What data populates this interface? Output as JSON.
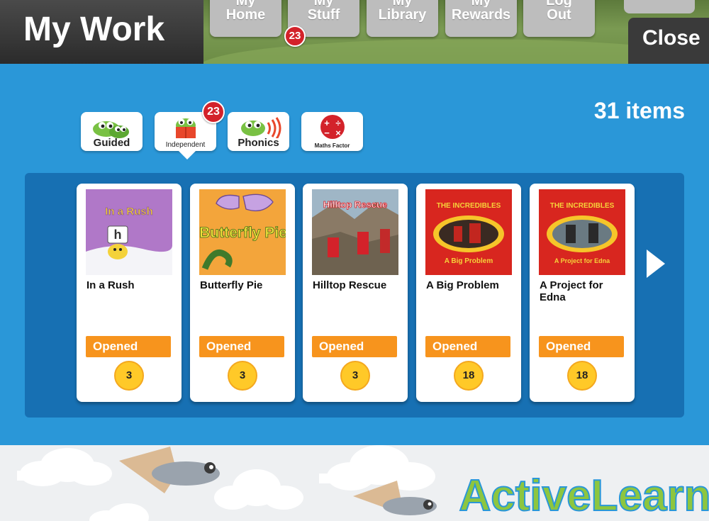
{
  "header": {
    "title": "My Work"
  },
  "nav": [
    {
      "line1": "My",
      "line2": "Home"
    },
    {
      "line1": "My",
      "line2": "Stuff"
    },
    {
      "line1": "My",
      "line2": "Library"
    },
    {
      "line1": "My",
      "line2": "Rewards"
    },
    {
      "line1": "Log",
      "line2": "Out"
    }
  ],
  "nav_badge": "23",
  "close_label": "Close",
  "items_count": "31 items",
  "tabs": [
    {
      "label": "Guided",
      "active": false
    },
    {
      "label": "Independent",
      "active": true
    },
    {
      "label": "Phonics",
      "active": false
    },
    {
      "label": "Maths Factor",
      "active": false
    }
  ],
  "tab_badge": "23",
  "books": [
    {
      "title": "In a Rush",
      "cover_title": "In a Rush",
      "status": "Opened",
      "level": "3"
    },
    {
      "title": "Butterfly Pie",
      "cover_title": "Butterfly Pie",
      "status": "Opened",
      "level": "3"
    },
    {
      "title": "Hilltop Rescue",
      "cover_title": "Hilltop Rescue",
      "status": "Opened",
      "level": "3"
    },
    {
      "title": "A Big Problem",
      "cover_title": "A Big Problem",
      "cover_series": "THE INCREDIBLES",
      "status": "Opened",
      "level": "18"
    },
    {
      "title": "A Project for Edna",
      "cover_title": "A Project for Edna",
      "cover_series": "THE INCREDIBLES",
      "status": "Opened",
      "level": "18"
    }
  ],
  "brand": {
    "name": "ActiveLearn"
  },
  "colors": {
    "accent": "#2a97d8",
    "status_orange": "#f7941d",
    "level_yellow": "#ffc928",
    "badge_red": "#d3222a"
  }
}
